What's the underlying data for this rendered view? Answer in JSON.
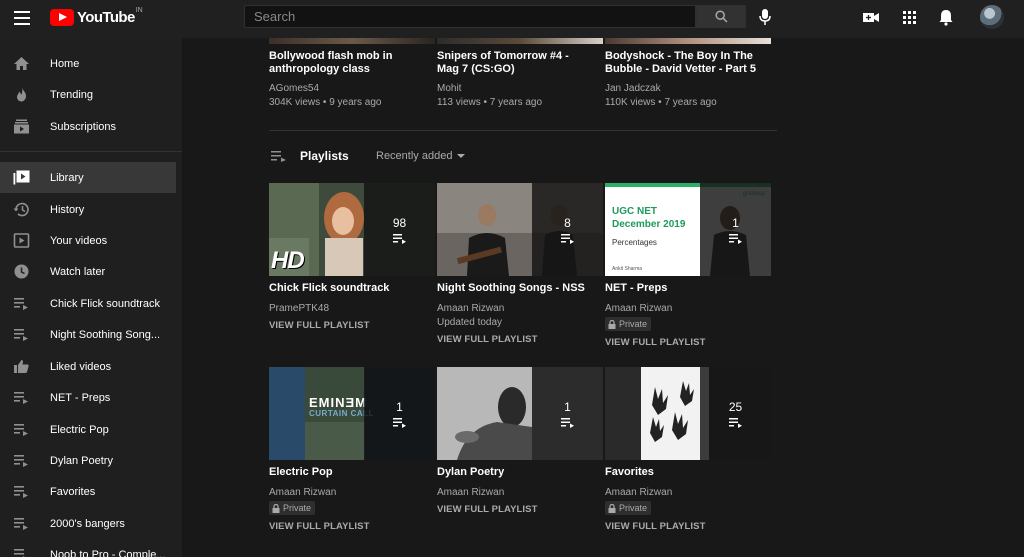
{
  "header": {
    "logo_text": "YouTube",
    "logo_country": "IN",
    "search_placeholder": "Search"
  },
  "sidebar": {
    "items": [
      {
        "label": "Home",
        "icon": "home-icon"
      },
      {
        "label": "Trending",
        "icon": "flame-icon"
      },
      {
        "label": "Subscriptions",
        "icon": "subscriptions-icon"
      },
      {
        "label": "Library",
        "icon": "library-icon",
        "active": true
      },
      {
        "label": "History",
        "icon": "history-icon"
      },
      {
        "label": "Your videos",
        "icon": "play-square-icon"
      },
      {
        "label": "Watch later",
        "icon": "clock-icon"
      },
      {
        "label": "Chick Flick soundtrack",
        "icon": "playlist-icon"
      },
      {
        "label": "Night Soothing Song...",
        "icon": "playlist-icon"
      },
      {
        "label": "Liked videos",
        "icon": "thumbs-up-icon"
      },
      {
        "label": "NET - Preps",
        "icon": "playlist-icon"
      },
      {
        "label": "Electric Pop",
        "icon": "playlist-icon"
      },
      {
        "label": "Dylan Poetry",
        "icon": "playlist-icon"
      },
      {
        "label": "Favorites",
        "icon": "playlist-icon"
      },
      {
        "label": "2000's bangers",
        "icon": "playlist-icon"
      },
      {
        "label": "Noob to Pro - Comple...",
        "icon": "playlist-icon"
      }
    ]
  },
  "videos": [
    {
      "title_line1": "Bollywood flash mob in",
      "title_line2": "anthropology class",
      "channel": "AGomes54",
      "stats": "304K views • 9 years ago"
    },
    {
      "title_line1": "Snipers of Tomorrow #4 -",
      "title_line2": "Mag 7 (CS:GO)",
      "channel": "Mohit",
      "stats": "113 views • 7 years ago"
    },
    {
      "title_line1": "Bodyshock - The Boy In The",
      "title_line2": "Bubble - David Vetter - Part 5",
      "channel": "Jan Jadczak",
      "stats": "110K views • 7 years ago"
    }
  ],
  "playlists_section": {
    "title": "Playlists",
    "sort_label": "Recently added"
  },
  "playlists": [
    {
      "title": "Chick Flick soundtrack",
      "owner": "PramePTK48",
      "count": "98",
      "sub": "",
      "private": false,
      "view_label": "VIEW FULL PLAYLIST",
      "thumb_text": "HD"
    },
    {
      "title": "Night Soothing Songs - NSS",
      "owner": "Amaan Rizwan",
      "count": "8",
      "sub": "Updated today",
      "private": false,
      "view_label": "VIEW FULL PLAYLIST",
      "thumb_text": ""
    },
    {
      "title": "NET - Preps",
      "owner": "Amaan Rizwan",
      "count": "1",
      "sub": "",
      "private": true,
      "private_label": "Private",
      "view_label": "VIEW FULL PLAYLIST",
      "thumb_text": "UGC NET December 2019",
      "thumb_sub": "Percentages",
      "thumb_small": "Ankit Sharma",
      "thumb_brand": "gradeup"
    },
    {
      "title": "Electric Pop",
      "owner": "Amaan Rizwan",
      "count": "1",
      "sub": "",
      "private": true,
      "private_label": "Private",
      "view_label": "VIEW FULL PLAYLIST",
      "thumb_text": "EMINƎM",
      "thumb_sub": "CURTAIN CALL"
    },
    {
      "title": "Dylan Poetry",
      "owner": "Amaan Rizwan",
      "count": "1",
      "sub": "",
      "private": false,
      "view_label": "VIEW FULL PLAYLIST",
      "thumb_text": ""
    },
    {
      "title": "Favorites",
      "owner": "Amaan Rizwan",
      "count": "25",
      "sub": "",
      "private": true,
      "private_label": "Private",
      "view_label": "VIEW FULL PLAYLIST",
      "thumb_text": ""
    }
  ]
}
